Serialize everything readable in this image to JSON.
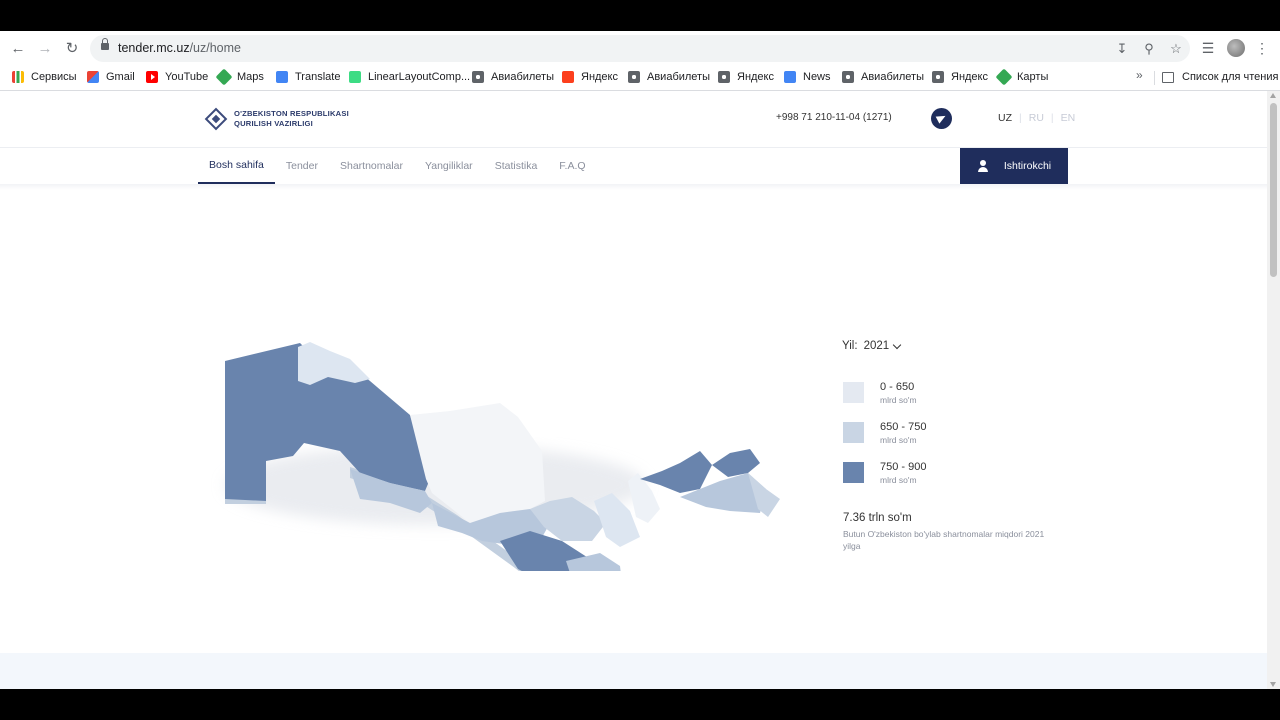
{
  "browser": {
    "url_domain": "tender.mc.uz",
    "url_path": "/uz/home",
    "bookmarks": [
      {
        "label": "Сервисы",
        "icon": "apps-grid-icon"
      },
      {
        "label": "Gmail",
        "icon": "gmail-icon"
      },
      {
        "label": "YouTube",
        "icon": "youtube-icon"
      },
      {
        "label": "Maps",
        "icon": "maps-icon"
      },
      {
        "label": "Translate",
        "icon": "translate-icon"
      },
      {
        "label": "LinearLayoutComp...",
        "icon": "android-icon"
      },
      {
        "label": "Авиабилеты",
        "icon": "globe-icon"
      },
      {
        "label": "Яндекс",
        "icon": "yandex-icon"
      },
      {
        "label": "Авиабилеты",
        "icon": "globe-icon"
      },
      {
        "label": "Яндекс",
        "icon": "globe-icon"
      },
      {
        "label": "News",
        "icon": "news-icon"
      },
      {
        "label": "Авиабилеты",
        "icon": "globe-icon"
      },
      {
        "label": "Яндекс",
        "icon": "globe-icon"
      },
      {
        "label": "Карты",
        "icon": "maps-icon"
      }
    ],
    "more_label": "»",
    "reading_list": "Список для чтения"
  },
  "header": {
    "logo_line1": "O'ZBEKISTON RESPUBLIKASI",
    "logo_line2": "QURILISH VAZIRLIGI",
    "phone": "+998 71 210-11-04 (1271)",
    "languages": [
      "UZ",
      "RU",
      "EN"
    ],
    "active_language": "UZ"
  },
  "nav": {
    "items": [
      "Bosh sahifa",
      "Tender",
      "Shartnomalar",
      "Yangiliklar",
      "Statistika",
      "F.A.Q"
    ],
    "active": "Bosh sahifa",
    "participant_button": "Ishtirokchi"
  },
  "stats": {
    "year_label": "Yil:",
    "year_value": "2021",
    "legend": [
      {
        "range": "0 - 650",
        "unit": "mlrd so'm",
        "color": "#e4e9f1"
      },
      {
        "range": "650 - 750",
        "unit": "mlrd so'm",
        "color": "#c9d5e4"
      },
      {
        "range": "750 - 900",
        "unit": "mlrd so'm",
        "color": "#6984ad"
      }
    ],
    "total_amount": "7.36 trln so'm",
    "total_desc": "Butun O'zbekiston bo'ylab shartnomalar miqdori 2021 yilga"
  },
  "colors": {
    "brand": "#1f2d5c",
    "map_low": "#edf1f6",
    "map_mid": "#b7c7dc",
    "map_high": "#6984ad"
  }
}
